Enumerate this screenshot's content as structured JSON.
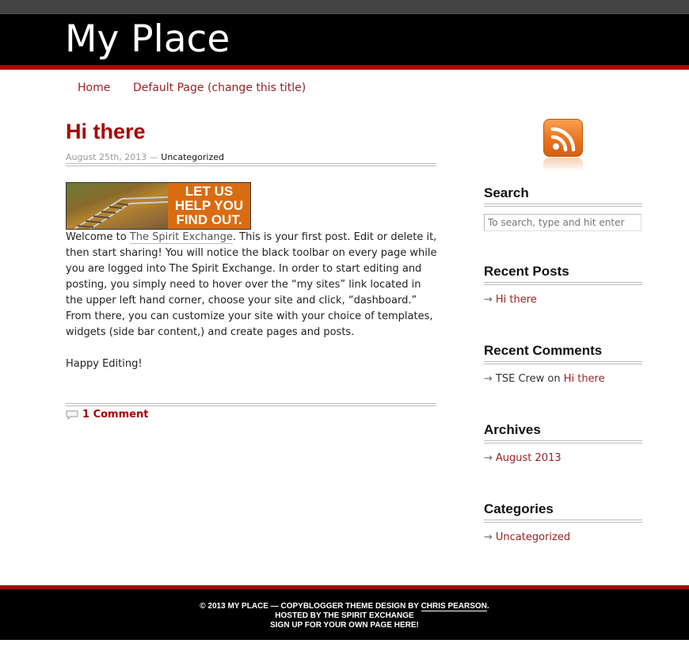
{
  "site": {
    "title": "My Place"
  },
  "nav": {
    "items": [
      "Home",
      "Default Page (change this title)"
    ]
  },
  "post": {
    "title": "Hi there",
    "date": "August 25th, 2013",
    "separator": "—",
    "category": "Uncategorized",
    "banner_text": [
      "LET US",
      "HELP YOU",
      "FIND OUT."
    ],
    "intro_before_link": "Welcome to ",
    "link_text": "The Spirit Exchange",
    "intro_after_link": ". This is your first post. Edit or delete it, then start sharing! You will notice the black toolbar on every page while you are logged into The Spirit Exchange. In order to start editing and posting, you simply need to hover over the “my sites” link located in the upper left hand corner, choose your site and click, “dashboard.” From there, you can customize your site with your choice of templates, widgets (side bar content,) and create pages and posts.",
    "closing": "Happy Editing!",
    "comments_label": "1 Comment"
  },
  "sidebar": {
    "search": {
      "title": "Search",
      "placeholder": "To search, type and hit enter"
    },
    "recent_posts": {
      "title": "Recent Posts",
      "items": [
        "Hi there"
      ]
    },
    "recent_comments": {
      "title": "Recent Comments",
      "author": "TSE Crew",
      "joiner": "on",
      "post": "Hi there"
    },
    "archives": {
      "title": "Archives",
      "items": [
        "August 2013"
      ]
    },
    "categories": {
      "title": "Categories",
      "items": [
        "Uncategorized"
      ]
    }
  },
  "footer": {
    "line1_prefix": "© 2013 MY PLACE — COPYBLOGGER THEME DESIGN BY ",
    "line1_link": "CHRIS PEARSON",
    "line1_suffix": ".",
    "line2": "HOSTED BY THE SPIRIT EXCHANGE",
    "line3": "SIGN UP FOR YOUR OWN PAGE HERE!"
  },
  "colors": {
    "accent_red": "#aa0000",
    "link_red": "#9b1f1f",
    "header_bg": "#000000",
    "rss_orange": "#e8701a"
  },
  "icons": {
    "feed": "rss-icon",
    "comment": "comment-bubble-icon",
    "bullet": "arrow-right-icon"
  }
}
